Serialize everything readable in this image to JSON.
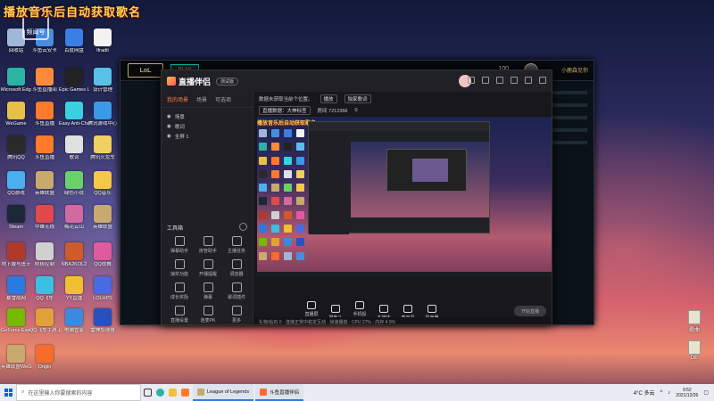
{
  "stream_title": "播放音乐后自动获取歌名",
  "watermark": {
    "label": "频闻号",
    "number": "7212"
  },
  "desktop_icons": [
    {
      "label": "回收站",
      "color": "#9fb8d8"
    },
    {
      "label": "斗鱼云安卡",
      "color": "#4a8ce0"
    },
    {
      "label": "百度网盘",
      "color": "#3a7ee8"
    },
    {
      "label": "Ifradit",
      "color": "#f2f2f2"
    },
    {
      "label": "Microsoft Edge",
      "color": "#2bb3a5"
    },
    {
      "label": "斗鱼直播间",
      "color": "#ff8a3a"
    },
    {
      "label": "Epic Games Launcher",
      "color": "#222222"
    },
    {
      "label": "设计管理",
      "color": "#59c0e8"
    },
    {
      "label": "WeGame",
      "color": "#e6c04a"
    },
    {
      "label": "斗鱼直播",
      "color": "#ff7a2a"
    },
    {
      "label": "Easy Anti-Cheat",
      "color": "#3ad0e0"
    },
    {
      "label": "腾讯游戏中心",
      "color": "#3a9ae8"
    },
    {
      "label": "腾讯QQ",
      "color": "#2a2a2a"
    },
    {
      "label": "斗鱼直播",
      "color": "#ff7a2a"
    },
    {
      "label": "歌词",
      "color": "#e0e0e0"
    },
    {
      "label": "腾讯火龙车",
      "color": "#f0d060"
    },
    {
      "label": "QQ游戏",
      "color": "#4ab0f0"
    },
    {
      "label": "英雄联盟",
      "color": "#c8aa6e"
    },
    {
      "label": "绿色小说",
      "color": "#6ad06a"
    },
    {
      "label": "QQ音乐",
      "color": "#f6c84a"
    },
    {
      "label": "Steam",
      "color": "#1b2838"
    },
    {
      "label": "中雄无线",
      "color": "#e04a4a"
    },
    {
      "label": "梅花云山",
      "color": "#d06aa0"
    },
    {
      "label": "英雄联盟",
      "color": "#c8aa6e"
    },
    {
      "label": "地下城与勇士",
      "color": "#b03a2a"
    },
    {
      "label": "终极控制",
      "color": "#d0d0d0"
    },
    {
      "label": "NBA2KOL2",
      "color": "#d05a2a"
    },
    {
      "label": "QQ炫舞",
      "color": "#e05aa0"
    },
    {
      "label": "暴雪战网",
      "color": "#2a7ae0"
    },
    {
      "label": "QQ飞车",
      "color": "#3ac0e0"
    },
    {
      "label": "YY直播",
      "color": "#f0c030"
    },
    {
      "label": "LOLHPS",
      "color": "#4a6ae0"
    },
    {
      "label": "GeForce Experience",
      "color": "#76b900"
    },
    {
      "label": "QQ飞车手游工具",
      "color": "#e0a03a"
    },
    {
      "label": "电脑管家",
      "color": "#3a8ae0"
    },
    {
      "label": "雷神加速器",
      "color": "#2a50c0"
    },
    {
      "label": "英雄联盟WeGame",
      "color": "#c8aa6e"
    },
    {
      "label": "Origin",
      "color": "#f56c2d"
    }
  ],
  "right_icons": [
    {
      "label": "歌曲"
    },
    {
      "label": "DE"
    }
  ],
  "lol": {
    "logo": "LoL",
    "play": "PLAY",
    "currency": "100",
    "user": "小鹿森见你"
  },
  "app": {
    "name": "直播伴侣",
    "version": "测试版",
    "tabs": [
      "我的场景",
      "场景",
      "可选项"
    ],
    "scenes": [
      "场景",
      "歌词",
      "全屏 1"
    ],
    "tools_title": "工具箱",
    "tools": [
      "弹幕助手",
      "房管助手",
      "主播任务",
      "抽奖功能",
      "开播提醒",
      "调音器",
      "成长奖励",
      "弹幕",
      "歌词插件",
      "直播设置",
      "连麦PK",
      "更多"
    ],
    "info_line1": "数据未获取当前个位置。",
    "info_pill1": "播放",
    "info_pill2": "独家歌词",
    "info_line2": "直播数据：大神标签",
    "info_room": "房间 7212366",
    "info_count": "0",
    "controls": [
      "直播屏幕",
      "摄像头",
      "手机投屏",
      "多媒体",
      "麦克风",
      "扬声器"
    ],
    "start_button": "开始直播",
    "status": "礼物/钻石   0 · 连接正常中稳定互动 · 帧速播放 · CPU 27% · 内存 4.9%"
  },
  "taskbar": {
    "search_placeholder": "在这里输入你要搜索的内容",
    "tasks": [
      "League of Legends",
      "斗鱼直播伴侣"
    ],
    "weather": "4°C 多云",
    "time": "9:52",
    "date": "2021/12/26"
  }
}
